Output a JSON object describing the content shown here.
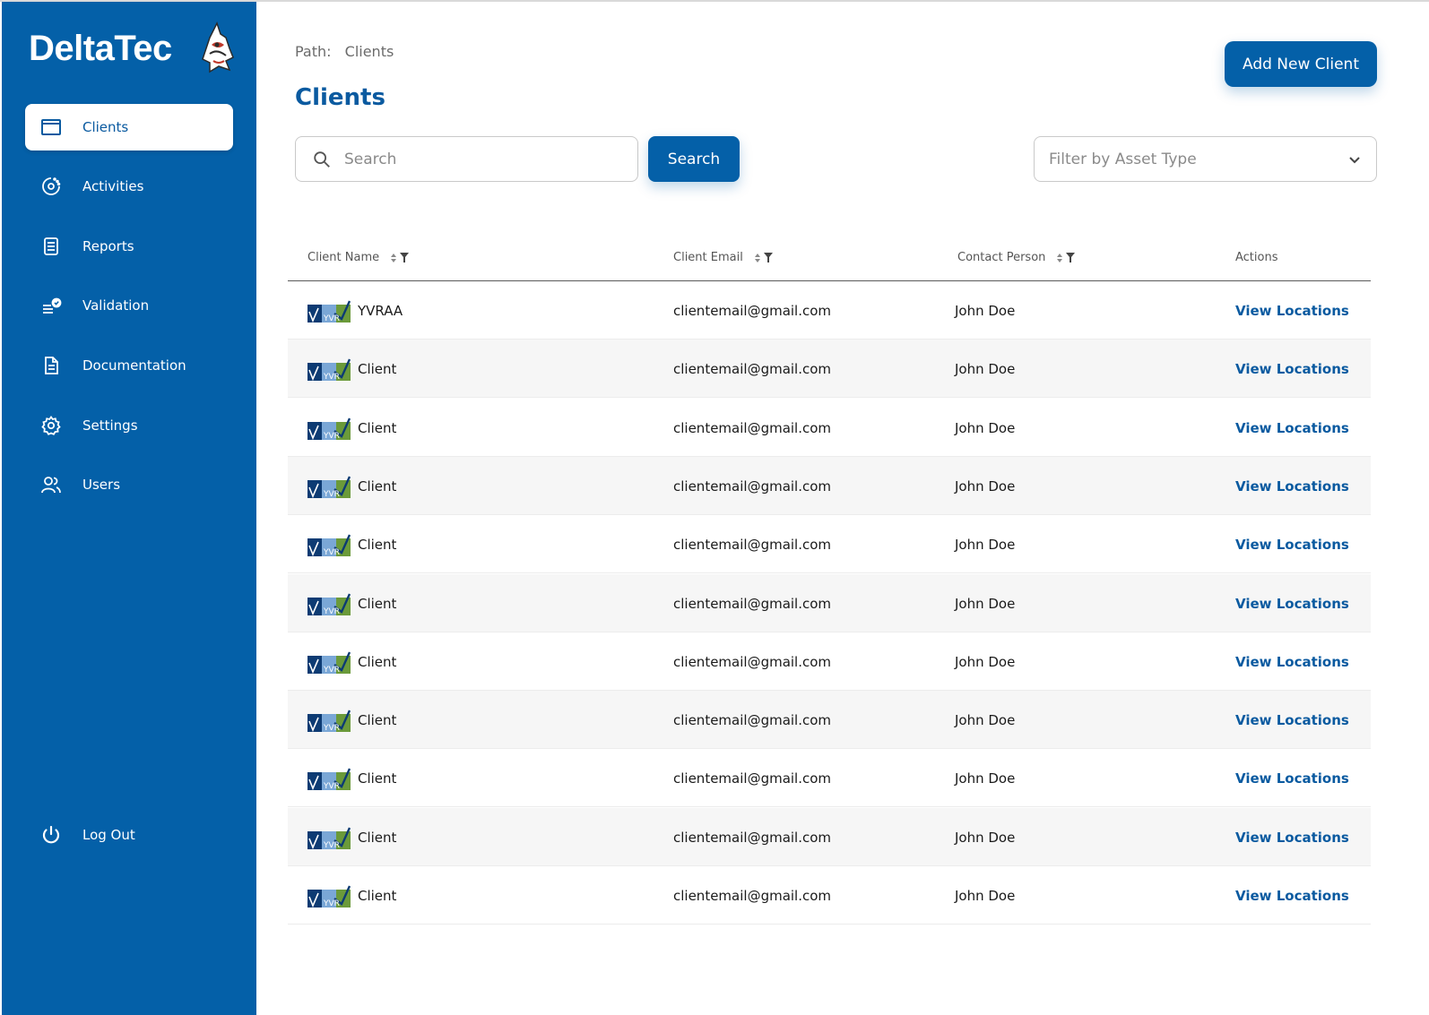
{
  "app": {
    "brand": "DeltaTec"
  },
  "sidebar": {
    "items": [
      {
        "label": "Clients",
        "icon": "window-icon",
        "active": true
      },
      {
        "label": "Activities",
        "icon": "activity-icon"
      },
      {
        "label": "Reports",
        "icon": "report-icon"
      },
      {
        "label": "Validation",
        "icon": "validation-icon"
      },
      {
        "label": "Documentation",
        "icon": "document-icon"
      },
      {
        "label": "Settings",
        "icon": "gear-icon"
      },
      {
        "label": "Users",
        "icon": "users-icon"
      }
    ],
    "logout": {
      "label": "Log Out",
      "icon": "power-icon"
    }
  },
  "header": {
    "path_label": "Path:",
    "path_value": "Clients",
    "title": "Clients",
    "add_button": "Add New Client"
  },
  "search": {
    "placeholder": "Search",
    "button": "Search"
  },
  "filter": {
    "placeholder": "Filter by Asset Type"
  },
  "table": {
    "columns": [
      "Client Name",
      "Client Email",
      "Contact Person",
      "Actions"
    ],
    "action_label": "View Locations",
    "logo_text": "YVR",
    "rows": [
      {
        "name": "YVRAA",
        "email": "clientemail@gmail.com",
        "contact": "John Doe"
      },
      {
        "name": "Client",
        "email": "clientemail@gmail.com",
        "contact": "John Doe"
      },
      {
        "name": "Client",
        "email": "clientemail@gmail.com",
        "contact": "John Doe"
      },
      {
        "name": "Client",
        "email": "clientemail@gmail.com",
        "contact": "John Doe"
      },
      {
        "name": "Client",
        "email": "clientemail@gmail.com",
        "contact": "John Doe"
      },
      {
        "name": "Client",
        "email": "clientemail@gmail.com",
        "contact": "John Doe"
      },
      {
        "name": "Client",
        "email": "clientemail@gmail.com",
        "contact": "John Doe"
      },
      {
        "name": "Client",
        "email": "clientemail@gmail.com",
        "contact": "John Doe"
      },
      {
        "name": "Client",
        "email": "clientemail@gmail.com",
        "contact": "John Doe"
      },
      {
        "name": "Client",
        "email": "clientemail@gmail.com",
        "contact": "John Doe"
      },
      {
        "name": "Client",
        "email": "clientemail@gmail.com",
        "contact": "John Doe"
      }
    ]
  },
  "colors": {
    "primary": "#0460a8",
    "link": "#0a5aa0",
    "row_alt": "#f6f6f6"
  }
}
